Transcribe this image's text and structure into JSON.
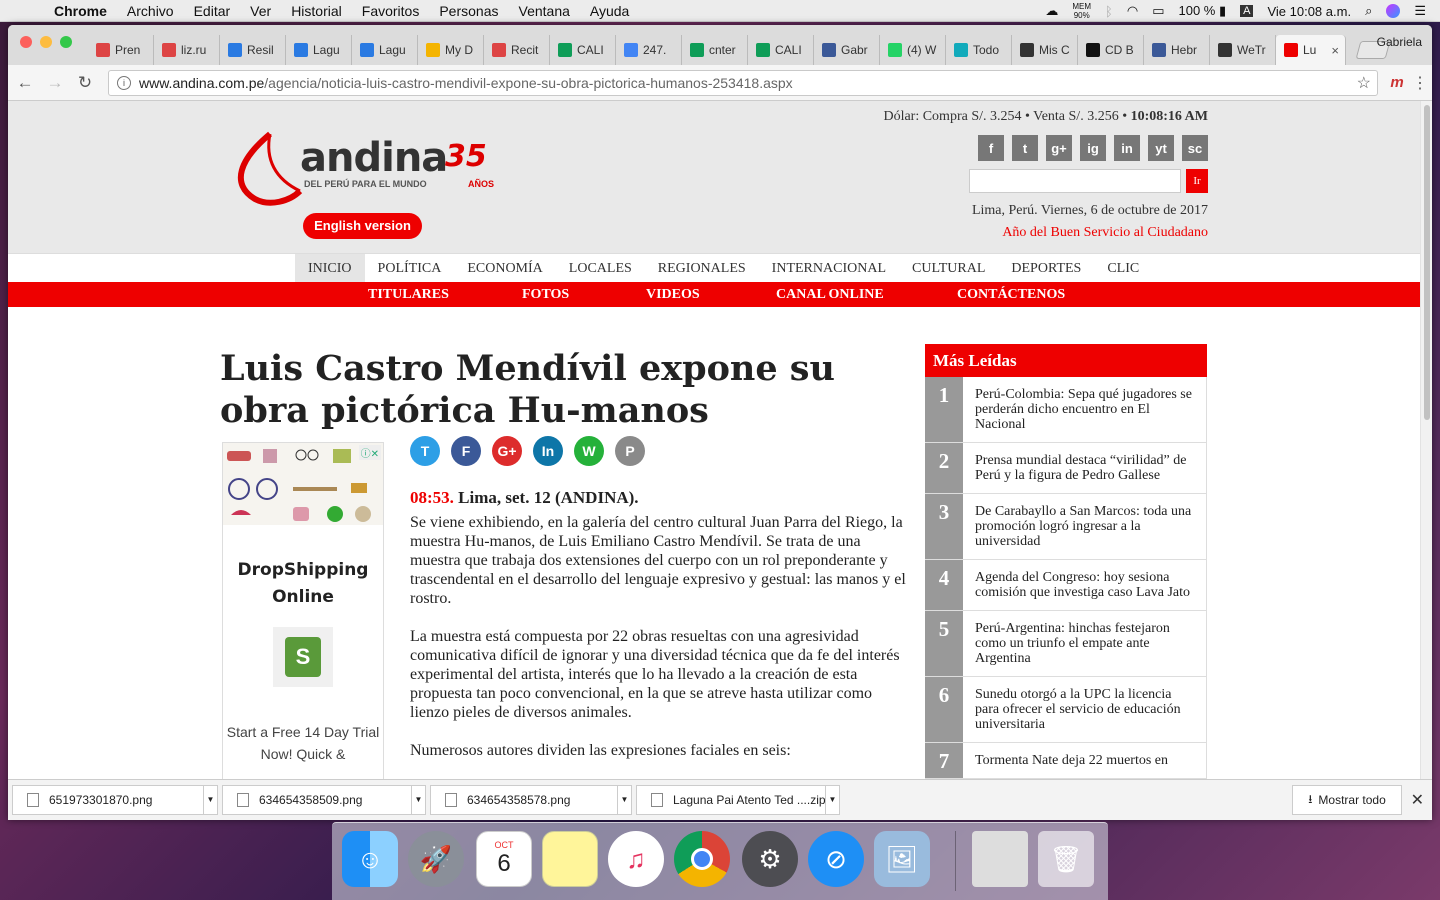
{
  "menubar": {
    "app": "Chrome",
    "items": [
      "Archivo",
      "Editar",
      "Ver",
      "Historial",
      "Favoritos",
      "Personas",
      "Ventana",
      "Ayuda"
    ],
    "mem": "MEM",
    "mem_pct": "90%",
    "battery": "100 %",
    "input": "A",
    "clock": "Vie 10:08 a.m."
  },
  "tabs": [
    {
      "label": "Pren",
      "icon": "gmail-icon",
      "color": "#d44"
    },
    {
      "label": "liz.ru",
      "icon": "gmail-icon",
      "color": "#d44"
    },
    {
      "label": "Resil",
      "icon": "dropbox-icon",
      "color": "#2a7ae2"
    },
    {
      "label": "Lagu",
      "icon": "dropbox-icon",
      "color": "#2a7ae2"
    },
    {
      "label": "Lagu",
      "icon": "dropbox-icon",
      "color": "#2a7ae2"
    },
    {
      "label": "My D",
      "icon": "drive-icon",
      "color": "#f4b400"
    },
    {
      "label": "Recit",
      "icon": "gmail-icon",
      "color": "#d44"
    },
    {
      "label": "CALI",
      "icon": "sheets-icon",
      "color": "#0f9d58"
    },
    {
      "label": "247.",
      "icon": "docs-icon",
      "color": "#4285f4"
    },
    {
      "label": "cnter",
      "icon": "sheets-icon",
      "color": "#0f9d58"
    },
    {
      "label": "CALI",
      "icon": "sheets-icon",
      "color": "#0f9d58"
    },
    {
      "label": "Gabr",
      "icon": "facebook-icon",
      "color": "#3b5998"
    },
    {
      "label": "(4) W",
      "icon": "whatsapp-icon",
      "color": "#25d366"
    },
    {
      "label": "Todo",
      "icon": "c-icon",
      "color": "#1ab"
    },
    {
      "label": "Mis C",
      "icon": "circle-icon",
      "color": "#333"
    },
    {
      "label": "CD B",
      "icon": "arrow-icon",
      "color": "#111"
    },
    {
      "label": "Hebr",
      "icon": "facebook-icon",
      "color": "#3b5998"
    },
    {
      "label": "WeTr",
      "icon": "wetransfer-icon",
      "color": "#333"
    },
    {
      "label": "Lu",
      "icon": "andina-icon",
      "color": "#e00",
      "active": true
    }
  ],
  "profile": "Gabriela",
  "url": {
    "domain": "www.andina.com.pe",
    "path": "/agencia/noticia-luis-castro-mendivil-expone-su-obra-pictorica-humanos-253418.aspx"
  },
  "header": {
    "rates_a": "Dólar: Compra S/. 3.254 • Venta S/. 3.256 • ",
    "rates_time": "10:08:16 AM",
    "socials": [
      "f",
      "t",
      "g+",
      "ig",
      "in",
      "yt",
      "sc"
    ],
    "search_btn": "Ir",
    "date": "Lima, Perú. Viernes, 6 de octubre de 2017",
    "motto": "Año del Buen Servicio al Ciudadano",
    "english": "English version",
    "logo_text": "andina",
    "logo_num": "35",
    "logo_tag": "DEL PERÚ PARA EL MUNDO",
    "logo_years": "AÑOS"
  },
  "nav1": [
    "INICIO",
    "POLÍTICA",
    "ECONOMÍA",
    "LOCALES",
    "REGIONALES",
    "INTERNACIONAL",
    "CULTURAL",
    "DEPORTES",
    "CLIC"
  ],
  "nav2": [
    "TITULARES",
    "FOTOS",
    "VIDEOS",
    "CANAL ONLINE",
    "CONTÁCTENOS"
  ],
  "article": {
    "title": "Luis Castro Mendívil expone su obra pictórica Hu-manos",
    "time": "08:53.",
    "dateline": " Lima, set. 12 (ANDINA).",
    "p1": "Se viene exhibiendo, en la galería del centro cultural Juan Parra del Riego, la muestra Hu-manos, de Luis Emiliano Castro Mendívil. Se trata de una muestra que trabaja dos extensiones del cuerpo con un rol preponderante y trascendental en el desarrollo del lenguaje expresivo y gestual: las manos y el rostro.",
    "p2": "La muestra está compuesta por 22 obras resueltas con una agresividad comunicativa difícil de ignorar y una diversidad técnica que da fe del interés experimental del artista, interés que lo ha llevado a la creación de esta propuesta tan poco convencional, en la que se atreve hasta utilizar como lienzo pieles de diversos animales.",
    "p3": "Numerosos autores dividen las expresiones faciales en seis:"
  },
  "share": [
    {
      "l": "T",
      "c": "#2d9fe6"
    },
    {
      "l": "F",
      "c": "#3b5998"
    },
    {
      "l": "G+",
      "c": "#dd2c2c"
    },
    {
      "l": "In",
      "c": "#0e76a8"
    },
    {
      "l": "W",
      "c": "#25b13a"
    },
    {
      "l": "P",
      "c": "#8a8a8a"
    }
  ],
  "ad": {
    "title": "DropShipping Online",
    "body": "Start a Free 14 Day Trial Now! Quick &"
  },
  "sidebar": {
    "title": "Más Leídas",
    "items": [
      {
        "n": "1",
        "t": "Perú-Colombia: Sepa qué jugadores se perderán dicho encuentro en El Nacional"
      },
      {
        "n": "2",
        "t": "Prensa mundial destaca “virilidad” de Perú y la figura de Pedro Gallese"
      },
      {
        "n": "3",
        "t": "De Carabayllo a San Marcos: toda una promoción logró ingresar a la universidad"
      },
      {
        "n": "4",
        "t": "Agenda del Congreso: hoy sesiona comisión que investiga caso Lava Jato"
      },
      {
        "n": "5",
        "t": "Perú-Argentina: hinchas festejaron como un triunfo el empate ante Argentina"
      },
      {
        "n": "6",
        "t": "Sunedu otorgó a la UPC la licencia para ofrecer el servicio de educación universitaria"
      },
      {
        "n": "7",
        "t": "Tormenta Nate deja 22 muertos en"
      }
    ]
  },
  "downloads": [
    "651973301870.png",
    "634654358509.png",
    "634654358578.png",
    "Laguna Pai Atento Ted ....zip"
  ],
  "show_all": "Mostrar todo",
  "dock_date": {
    "month": "OCT",
    "day": "6"
  }
}
